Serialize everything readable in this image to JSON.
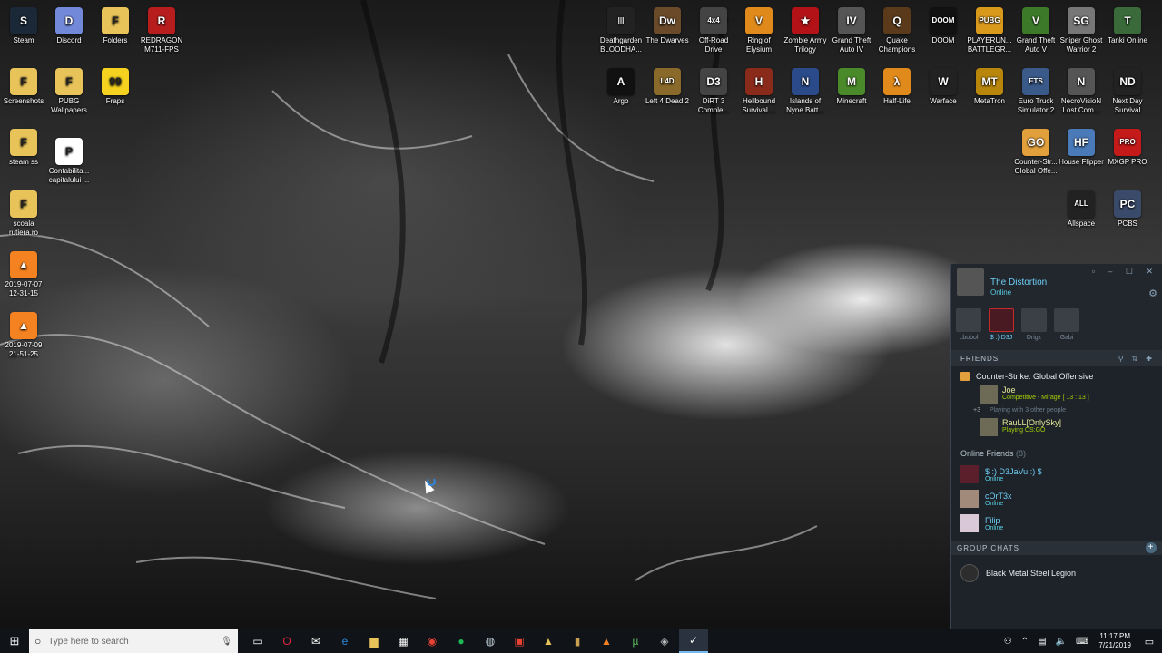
{
  "desktop_icons": [
    {
      "label": "Steam",
      "color": "#1b2838",
      "glyph": "S"
    },
    {
      "label": "Discord",
      "color": "#7289da",
      "glyph": "D"
    },
    {
      "label": "Folders",
      "color": "#e8c35a",
      "glyph": "F"
    },
    {
      "label": "REDRAGON M711-FPS",
      "color": "#b81d1d",
      "glyph": "R"
    },
    {
      "label": "Screenshots",
      "color": "#e8c35a",
      "glyph": "F"
    },
    {
      "label": "PUBG Wallpapers",
      "color": "#e8c35a",
      "glyph": "F"
    },
    {
      "label": "Fraps",
      "color": "#f4d21f",
      "glyph": "99"
    },
    {
      "label": "steam ss",
      "color": "#e8c35a",
      "glyph": "F"
    },
    {
      "label": "Contabilita... capitalului ...",
      "color": "#ffffff",
      "glyph": "P"
    },
    {
      "label": "scoala rutiera.ro",
      "color": "#e8c35a",
      "glyph": "F"
    },
    {
      "label": "2019-07-07 12-31-15",
      "color": "#f58220",
      "glyph": "▲"
    },
    {
      "label": "2019-07-09 21-51-25",
      "color": "#f58220",
      "glyph": "▲"
    },
    {
      "label": "Deathgarden BLOODHA...",
      "color": "#222222",
      "glyph": "|||"
    },
    {
      "label": "The Dwarves",
      "color": "#6b4a2a",
      "glyph": "Dw"
    },
    {
      "label": "Off-Road Drive",
      "color": "#444444",
      "glyph": "4x4"
    },
    {
      "label": "Ring of Elysium",
      "color": "#e08a1b",
      "glyph": "V"
    },
    {
      "label": "Zombie Army Trilogy",
      "color": "#b31217",
      "glyph": "★"
    },
    {
      "label": "Grand Theft Auto IV",
      "color": "#555555",
      "glyph": "IV"
    },
    {
      "label": "Quake Champions",
      "color": "#5a3a1a",
      "glyph": "Q"
    },
    {
      "label": "DOOM",
      "color": "#111111",
      "glyph": "DOOM"
    },
    {
      "label": "PLAYERUN... BATTLEGR...",
      "color": "#d99a1c",
      "glyph": "PUBG"
    },
    {
      "label": "Grand Theft Auto V",
      "color": "#3c7a2a",
      "glyph": "V"
    },
    {
      "label": "Sniper Ghost Warrior 2",
      "color": "#777777",
      "glyph": "SG"
    },
    {
      "label": "Tanki Online",
      "color": "#3a6a3a",
      "glyph": "T"
    },
    {
      "label": "Argo",
      "color": "#111111",
      "glyph": "A"
    },
    {
      "label": "Left 4 Dead 2",
      "color": "#8a6a2a",
      "glyph": "L4D"
    },
    {
      "label": "DiRT 3 Comple...",
      "color": "#444444",
      "glyph": "D3"
    },
    {
      "label": "Hellbound Survival ...",
      "color": "#8a2a1a",
      "glyph": "H"
    },
    {
      "label": "Islands of Nyne Batt...",
      "color": "#2a4a8a",
      "glyph": "N"
    },
    {
      "label": "Minecraft",
      "color": "#4a8a2a",
      "glyph": "M"
    },
    {
      "label": "Half-Life",
      "color": "#e08a1b",
      "glyph": "λ"
    },
    {
      "label": "Warface",
      "color": "#222222",
      "glyph": "W"
    },
    {
      "label": "MetaTron",
      "color": "#b8860b",
      "glyph": "MT"
    },
    {
      "label": "Euro Truck Simulator 2",
      "color": "#3a5a8a",
      "glyph": "ETS"
    },
    {
      "label": "NecroVisioN Lost Com...",
      "color": "#555555",
      "glyph": "N"
    },
    {
      "label": "Next Day Survival",
      "color": "#222222",
      "glyph": "ND"
    },
    {
      "label": "Counter-Str... Global Offe...",
      "color": "#e2a03c",
      "glyph": "GO"
    },
    {
      "label": "House Flipper",
      "color": "#4a7ab8",
      "glyph": "HF"
    },
    {
      "label": "MXGP PRO",
      "color": "#c41a1a",
      "glyph": "PRO"
    },
    {
      "label": "Allspace",
      "color": "#222222",
      "glyph": "ALL"
    },
    {
      "label": "PCBS",
      "color": "#3a4a6a",
      "glyph": "PC"
    }
  ],
  "friends_panel": {
    "user_name": "The Distortion",
    "user_status": "Online",
    "window_buttons": "▫ – ☐ ✕",
    "recent": [
      {
        "name": "Lbobol"
      },
      {
        "name": "$ :) D3J"
      },
      {
        "name": "Drigz"
      },
      {
        "name": "Gabi"
      }
    ],
    "friends_header": "FRIENDS",
    "game_group": {
      "game": "Counter-Strike: Global Offensive",
      "player1_name": "Joe",
      "player1_status": "Competitive - Mirage [ 13 : 13 ]",
      "more_count": "+3",
      "more_text": "Playing with 3 other people",
      "player2_name": "RauLL[OnlySky]",
      "player2_status": "Playing CS:GO"
    },
    "online_header": "Online Friends",
    "online_count": "(8)",
    "online_friends": [
      {
        "name": "$ :) D3JaVu :) $",
        "status": "Online"
      },
      {
        "name": "cOrT3x",
        "status": "Online"
      },
      {
        "name": "Filip",
        "status": "Online"
      }
    ],
    "group_chats_header": "GROUP CHATS",
    "group_chat_name": "Black Metal Steel Legion"
  },
  "taskbar": {
    "search_placeholder": "Type here to search",
    "time": "11:17 PM",
    "date": "7/21/2019"
  }
}
